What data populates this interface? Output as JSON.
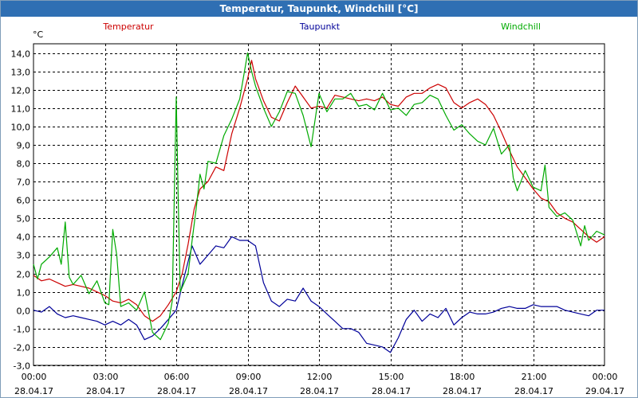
{
  "window": {
    "title": "Temperatur, Taupunkt, Windchill [°C]"
  },
  "colors": {
    "title_bar": "#2f6fb3",
    "temperatur": "#cc0000",
    "taupunkt": "#000099",
    "windchill": "#00aa00"
  },
  "chart_data": {
    "type": "line",
    "title": "Temperatur, Taupunkt, Windchill [°C]",
    "ylabel": "°C",
    "xlabel": "",
    "ylim": [
      -3.0,
      14.5
    ],
    "y_ticks": [
      "14,0",
      "13,0",
      "12,0",
      "11,0",
      "10,0",
      "9,0",
      "8,0",
      "7,0",
      "6,0",
      "5,0",
      "4,0",
      "3,0",
      "2,0",
      "1,0",
      "0,0",
      "-1,0",
      "-2,0",
      "-3,0"
    ],
    "x_ticks": [
      {
        "time": "00:00",
        "date": "28.04.17"
      },
      {
        "time": "03:00",
        "date": "28.04.17"
      },
      {
        "time": "06:00",
        "date": "28.04.17"
      },
      {
        "time": "09:00",
        "date": "28.04.17"
      },
      {
        "time": "12:00",
        "date": "28.04.17"
      },
      {
        "time": "15:00",
        "date": "28.04.17"
      },
      {
        "time": "18:00",
        "date": "28.04.17"
      },
      {
        "time": "21:00",
        "date": "28.04.17"
      },
      {
        "time": "00:00",
        "date": "29.04.17"
      }
    ],
    "grid": true,
    "legend_position": "top",
    "series": [
      {
        "name": "Temperatur",
        "color": "#cc0000",
        "points": [
          [
            "28.04.17 00:00",
            1.9
          ],
          [
            "28.04.17 00:20",
            1.6
          ],
          [
            "28.04.17 00:40",
            1.7
          ],
          [
            "28.04.17 01:00",
            1.5
          ],
          [
            "28.04.17 01:20",
            1.3
          ],
          [
            "28.04.17 01:40",
            1.4
          ],
          [
            "28.04.17 02:00",
            1.3
          ],
          [
            "28.04.17 02:20",
            1.2
          ],
          [
            "28.04.17 02:40",
            1.0
          ],
          [
            "28.04.17 03:00",
            0.8
          ],
          [
            "28.04.17 03:20",
            0.5
          ],
          [
            "28.04.17 03:40",
            0.4
          ],
          [
            "28.04.17 04:00",
            0.6
          ],
          [
            "28.04.17 04:20",
            0.3
          ],
          [
            "28.04.17 04:40",
            -0.3
          ],
          [
            "28.04.17 05:00",
            -0.6
          ],
          [
            "28.04.17 05:20",
            -0.3
          ],
          [
            "28.04.17 05:40",
            0.3
          ],
          [
            "28.04.17 06:00",
            1.0
          ],
          [
            "28.04.17 06:15",
            2.0
          ],
          [
            "28.04.17 06:30",
            3.6
          ],
          [
            "28.04.17 06:45",
            5.5
          ],
          [
            "28.04.17 07:00",
            6.6
          ],
          [
            "28.04.17 07:20",
            7.0
          ],
          [
            "28.04.17 07:40",
            7.8
          ],
          [
            "28.04.17 08:00",
            7.6
          ],
          [
            "28.04.17 08:20",
            9.6
          ],
          [
            "28.04.17 08:40",
            11.0
          ],
          [
            "28.04.17 09:00",
            12.6
          ],
          [
            "28.04.17 09:10",
            13.6
          ],
          [
            "28.04.17 09:20",
            12.6
          ],
          [
            "28.04.17 09:40",
            11.4
          ],
          [
            "28.04.17 10:00",
            10.5
          ],
          [
            "28.04.17 10:20",
            10.3
          ],
          [
            "28.04.17 10:40",
            11.3
          ],
          [
            "28.04.17 11:00",
            12.2
          ],
          [
            "28.04.17 11:20",
            11.6
          ],
          [
            "28.04.17 11:40",
            11.0
          ],
          [
            "28.04.17 12:00",
            11.1
          ],
          [
            "28.04.17 12:20",
            11.0
          ],
          [
            "28.04.17 12:40",
            11.7
          ],
          [
            "28.04.17 13:00",
            11.6
          ],
          [
            "28.04.17 13:20",
            11.5
          ],
          [
            "28.04.17 13:40",
            11.4
          ],
          [
            "28.04.17 14:00",
            11.5
          ],
          [
            "28.04.17 14:20",
            11.4
          ],
          [
            "28.04.17 14:40",
            11.6
          ],
          [
            "28.04.17 15:00",
            11.2
          ],
          [
            "28.04.17 15:20",
            11.1
          ],
          [
            "28.04.17 15:40",
            11.6
          ],
          [
            "28.04.17 16:00",
            11.8
          ],
          [
            "28.04.17 16:20",
            11.8
          ],
          [
            "28.04.17 16:40",
            12.1
          ],
          [
            "28.04.17 17:00",
            12.3
          ],
          [
            "28.04.17 17:20",
            12.1
          ],
          [
            "28.04.17 17:40",
            11.3
          ],
          [
            "28.04.17 18:00",
            11.0
          ],
          [
            "28.04.17 18:20",
            11.3
          ],
          [
            "28.04.17 18:40",
            11.5
          ],
          [
            "28.04.17 19:00",
            11.2
          ],
          [
            "28.04.17 19:20",
            10.6
          ],
          [
            "28.04.17 19:40",
            9.7
          ],
          [
            "28.04.17 20:00",
            8.7
          ],
          [
            "28.04.17 20:20",
            7.8
          ],
          [
            "28.04.17 20:40",
            7.2
          ],
          [
            "28.04.17 21:00",
            6.6
          ],
          [
            "28.04.17 21:20",
            6.1
          ],
          [
            "28.04.17 21:40",
            5.9
          ],
          [
            "28.04.17 22:00",
            5.3
          ],
          [
            "28.04.17 22:20",
            5.0
          ],
          [
            "28.04.17 22:40",
            4.8
          ],
          [
            "28.04.17 23:00",
            4.4
          ],
          [
            "28.04.17 23:20",
            4.0
          ],
          [
            "28.04.17 23:40",
            3.7
          ],
          [
            "29.04.17 00:00",
            4.0
          ]
        ]
      },
      {
        "name": "Taupunkt",
        "color": "#000099",
        "points": [
          [
            "28.04.17 00:00",
            0.0
          ],
          [
            "28.04.17 00:20",
            -0.1
          ],
          [
            "28.04.17 00:40",
            0.2
          ],
          [
            "28.04.17 01:00",
            -0.2
          ],
          [
            "28.04.17 01:20",
            -0.4
          ],
          [
            "28.04.17 01:40",
            -0.3
          ],
          [
            "28.04.17 02:00",
            -0.4
          ],
          [
            "28.04.17 02:20",
            -0.5
          ],
          [
            "28.04.17 02:40",
            -0.6
          ],
          [
            "28.04.17 03:00",
            -0.8
          ],
          [
            "28.04.17 03:20",
            -0.6
          ],
          [
            "28.04.17 03:40",
            -0.8
          ],
          [
            "28.04.17 04:00",
            -0.5
          ],
          [
            "28.04.17 04:20",
            -0.8
          ],
          [
            "28.04.17 04:40",
            -1.6
          ],
          [
            "28.04.17 05:00",
            -1.4
          ],
          [
            "28.04.17 05:20",
            -1.0
          ],
          [
            "28.04.17 05:40",
            -0.5
          ],
          [
            "28.04.17 06:00",
            0.0
          ],
          [
            "28.04.17 06:20",
            1.8
          ],
          [
            "28.04.17 06:40",
            3.5
          ],
          [
            "28.04.17 07:00",
            2.5
          ],
          [
            "28.04.17 07:20",
            3.0
          ],
          [
            "28.04.17 07:40",
            3.5
          ],
          [
            "28.04.17 08:00",
            3.4
          ],
          [
            "28.04.17 08:20",
            4.0
          ],
          [
            "28.04.17 08:40",
            3.8
          ],
          [
            "28.04.17 09:00",
            3.8
          ],
          [
            "28.04.17 09:20",
            3.5
          ],
          [
            "28.04.17 09:40",
            1.5
          ],
          [
            "28.04.17 10:00",
            0.5
          ],
          [
            "28.04.17 10:20",
            0.2
          ],
          [
            "28.04.17 10:40",
            0.6
          ],
          [
            "28.04.17 11:00",
            0.5
          ],
          [
            "28.04.17 11:20",
            1.2
          ],
          [
            "28.04.17 11:40",
            0.5
          ],
          [
            "28.04.17 12:00",
            0.2
          ],
          [
            "28.04.17 12:20",
            -0.2
          ],
          [
            "28.04.17 12:40",
            -0.6
          ],
          [
            "28.04.17 13:00",
            -1.0
          ],
          [
            "28.04.17 13:20",
            -1.0
          ],
          [
            "28.04.17 13:40",
            -1.2
          ],
          [
            "28.04.17 14:00",
            -1.8
          ],
          [
            "28.04.17 14:20",
            -1.9
          ],
          [
            "28.04.17 14:40",
            -2.0
          ],
          [
            "28.04.17 15:00",
            -2.3
          ],
          [
            "28.04.17 15:20",
            -1.5
          ],
          [
            "28.04.17 15:40",
            -0.5
          ],
          [
            "28.04.17 16:00",
            0.0
          ],
          [
            "28.04.17 16:20",
            -0.6
          ],
          [
            "28.04.17 16:40",
            -0.2
          ],
          [
            "28.04.17 17:00",
            -0.4
          ],
          [
            "28.04.17 17:20",
            0.1
          ],
          [
            "28.04.17 17:40",
            -0.8
          ],
          [
            "28.04.17 18:00",
            -0.4
          ],
          [
            "28.04.17 18:20",
            -0.1
          ],
          [
            "28.04.17 18:40",
            -0.2
          ],
          [
            "28.04.17 19:00",
            -0.2
          ],
          [
            "28.04.17 19:20",
            -0.1
          ],
          [
            "28.04.17 19:40",
            0.1
          ],
          [
            "28.04.17 20:00",
            0.2
          ],
          [
            "28.04.17 20:20",
            0.1
          ],
          [
            "28.04.17 20:40",
            0.1
          ],
          [
            "28.04.17 21:00",
            0.3
          ],
          [
            "28.04.17 21:20",
            0.2
          ],
          [
            "28.04.17 21:40",
            0.2
          ],
          [
            "28.04.17 22:00",
            0.2
          ],
          [
            "28.04.17 22:20",
            0.0
          ],
          [
            "28.04.17 22:40",
            -0.1
          ],
          [
            "28.04.17 23:00",
            -0.2
          ],
          [
            "28.04.17 23:20",
            -0.3
          ],
          [
            "28.04.17 23:40",
            0.0
          ],
          [
            "29.04.17 00:00",
            0.0
          ]
        ]
      },
      {
        "name": "Windchill",
        "color": "#00aa00",
        "points": [
          [
            "28.04.17 00:00",
            2.5
          ],
          [
            "28.04.17 00:10",
            1.7
          ],
          [
            "28.04.17 00:20",
            2.5
          ],
          [
            "28.04.17 00:40",
            2.9
          ],
          [
            "28.04.17 01:00",
            3.4
          ],
          [
            "28.04.17 01:10",
            2.5
          ],
          [
            "28.04.17 01:20",
            4.8
          ],
          [
            "28.04.17 01:30",
            1.8
          ],
          [
            "28.04.17 01:40",
            1.4
          ],
          [
            "28.04.17 02:00",
            1.9
          ],
          [
            "28.04.17 02:20",
            0.9
          ],
          [
            "28.04.17 02:40",
            1.6
          ],
          [
            "28.04.17 02:50",
            1.0
          ],
          [
            "28.04.17 03:00",
            0.4
          ],
          [
            "28.04.17 03:10",
            0.3
          ],
          [
            "28.04.17 03:20",
            4.4
          ],
          [
            "28.04.17 03:30",
            3.0
          ],
          [
            "28.04.17 03:40",
            0.2
          ],
          [
            "28.04.17 04:00",
            0.4
          ],
          [
            "28.04.17 04:20",
            0.0
          ],
          [
            "28.04.17 04:40",
            1.0
          ],
          [
            "28.04.17 05:00",
            -1.2
          ],
          [
            "28.04.17 05:20",
            -1.6
          ],
          [
            "28.04.17 05:40",
            -0.7
          ],
          [
            "28.04.17 05:50",
            0.5
          ],
          [
            "28.04.17 06:00",
            11.6
          ],
          [
            "28.04.17 06:05",
            6.0
          ],
          [
            "28.04.17 06:10",
            1.0
          ],
          [
            "28.04.17 06:30",
            2.0
          ],
          [
            "28.04.17 06:40",
            3.8
          ],
          [
            "28.04.17 06:50",
            5.5
          ],
          [
            "28.04.17 07:00",
            7.4
          ],
          [
            "28.04.17 07:10",
            6.6
          ],
          [
            "28.04.17 07:20",
            8.1
          ],
          [
            "28.04.17 07:40",
            8.0
          ],
          [
            "28.04.17 08:00",
            9.5
          ],
          [
            "28.04.17 08:20",
            10.4
          ],
          [
            "28.04.17 08:40",
            11.5
          ],
          [
            "28.04.17 09:00",
            14.0
          ],
          [
            "28.04.17 09:10",
            13.0
          ],
          [
            "28.04.17 09:20",
            12.2
          ],
          [
            "28.04.17 09:40",
            11.0
          ],
          [
            "28.04.17 10:00",
            10.0
          ],
          [
            "28.04.17 10:20",
            10.8
          ],
          [
            "28.04.17 10:40",
            11.9
          ],
          [
            "28.04.17 11:00",
            11.8
          ],
          [
            "28.04.17 11:20",
            10.6
          ],
          [
            "28.04.17 11:40",
            8.9
          ],
          [
            "28.04.17 12:00",
            11.8
          ],
          [
            "28.04.17 12:20",
            10.8
          ],
          [
            "28.04.17 12:40",
            11.5
          ],
          [
            "28.04.17 13:00",
            11.5
          ],
          [
            "28.04.17 13:20",
            11.8
          ],
          [
            "28.04.17 13:40",
            11.1
          ],
          [
            "28.04.17 14:00",
            11.2
          ],
          [
            "28.04.17 14:20",
            10.9
          ],
          [
            "28.04.17 14:40",
            11.8
          ],
          [
            "28.04.17 15:00",
            10.9
          ],
          [
            "28.04.17 15:20",
            11.0
          ],
          [
            "28.04.17 15:40",
            10.6
          ],
          [
            "28.04.17 16:00",
            11.2
          ],
          [
            "28.04.17 16:20",
            11.3
          ],
          [
            "28.04.17 16:40",
            11.7
          ],
          [
            "28.04.17 17:00",
            11.5
          ],
          [
            "28.04.17 17:20",
            10.6
          ],
          [
            "28.04.17 17:40",
            9.8
          ],
          [
            "28.04.17 18:00",
            10.1
          ],
          [
            "28.04.17 18:20",
            9.6
          ],
          [
            "28.04.17 18:40",
            9.2
          ],
          [
            "28.04.17 19:00",
            9.0
          ],
          [
            "28.04.17 19:20",
            9.9
          ],
          [
            "28.04.17 19:40",
            8.5
          ],
          [
            "28.04.17 20:00",
            9.0
          ],
          [
            "28.04.17 20:10",
            7.2
          ],
          [
            "28.04.17 20:20",
            6.5
          ],
          [
            "28.04.17 20:40",
            7.6
          ],
          [
            "28.04.17 21:00",
            6.7
          ],
          [
            "28.04.17 21:20",
            6.5
          ],
          [
            "28.04.17 21:30",
            7.9
          ],
          [
            "28.04.17 21:40",
            5.6
          ],
          [
            "28.04.17 22:00",
            5.1
          ],
          [
            "28.04.17 22:20",
            5.3
          ],
          [
            "28.04.17 22:40",
            4.9
          ],
          [
            "28.04.17 23:00",
            3.5
          ],
          [
            "28.04.17 23:10",
            4.6
          ],
          [
            "28.04.17 23:20",
            3.8
          ],
          [
            "28.04.17 23:40",
            4.3
          ],
          [
            "29.04.17 00:00",
            4.1
          ]
        ]
      }
    ]
  }
}
